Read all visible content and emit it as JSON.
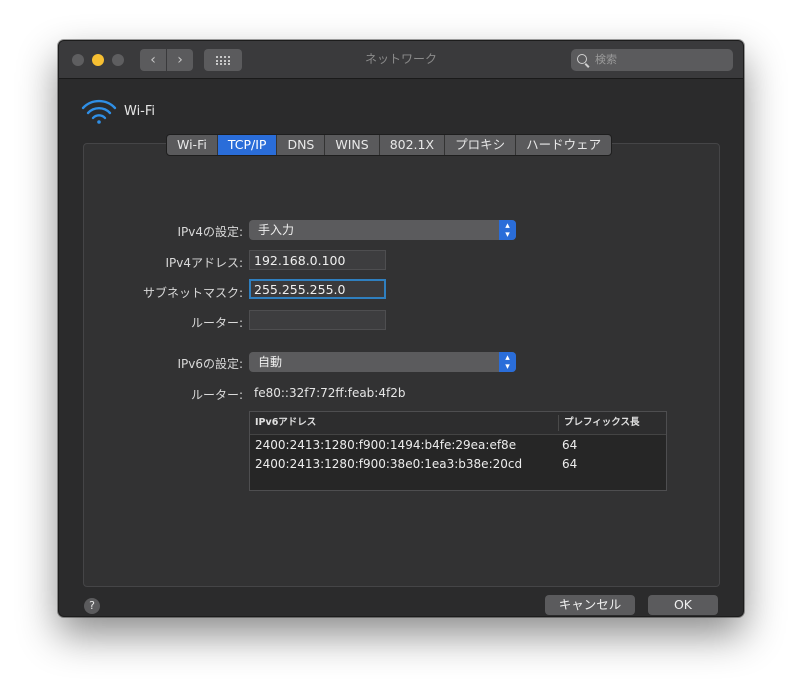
{
  "window": {
    "title": "ネットワーク"
  },
  "search": {
    "placeholder": "検索"
  },
  "header": {
    "service_name": "Wi-Fi"
  },
  "tabs": [
    {
      "label": "Wi-Fi",
      "active": false
    },
    {
      "label": "TCP/IP",
      "active": true
    },
    {
      "label": "DNS",
      "active": false
    },
    {
      "label": "WINS",
      "active": false
    },
    {
      "label": "802.1X",
      "active": false
    },
    {
      "label": "プロキシ",
      "active": false
    },
    {
      "label": "ハードウェア",
      "active": false
    }
  ],
  "ipv4": {
    "config_label": "IPv4の設定:",
    "config_value": "手入力",
    "address_label": "IPv4アドレス:",
    "address_value": "192.168.0.100",
    "subnet_label": "サブネットマスク:",
    "subnet_value": "255.255.255.0",
    "router_label": "ルーター:",
    "router_value": ""
  },
  "ipv6": {
    "config_label": "IPv6の設定:",
    "config_value": "自動",
    "router_label": "ルーター:",
    "router_value": "fe80::32f7:72ff:feab:4f2b",
    "table": {
      "headers": [
        "IPv6アドレス",
        "プレフィックス長"
      ],
      "rows": [
        {
          "address": "2400:2413:1280:f900:1494:b4fe:29ea:ef8e",
          "prefix": "64"
        },
        {
          "address": "2400:2413:1280:f900:38e0:1ea3:b38e:20cd",
          "prefix": "64"
        }
      ]
    }
  },
  "footer": {
    "help": "?",
    "cancel_label": "キャンセル",
    "ok_label": "OK"
  },
  "colors": {
    "accent": "#2a6dd9",
    "window_bg": "#2b2b2c",
    "minimize": "#f6bf32"
  }
}
